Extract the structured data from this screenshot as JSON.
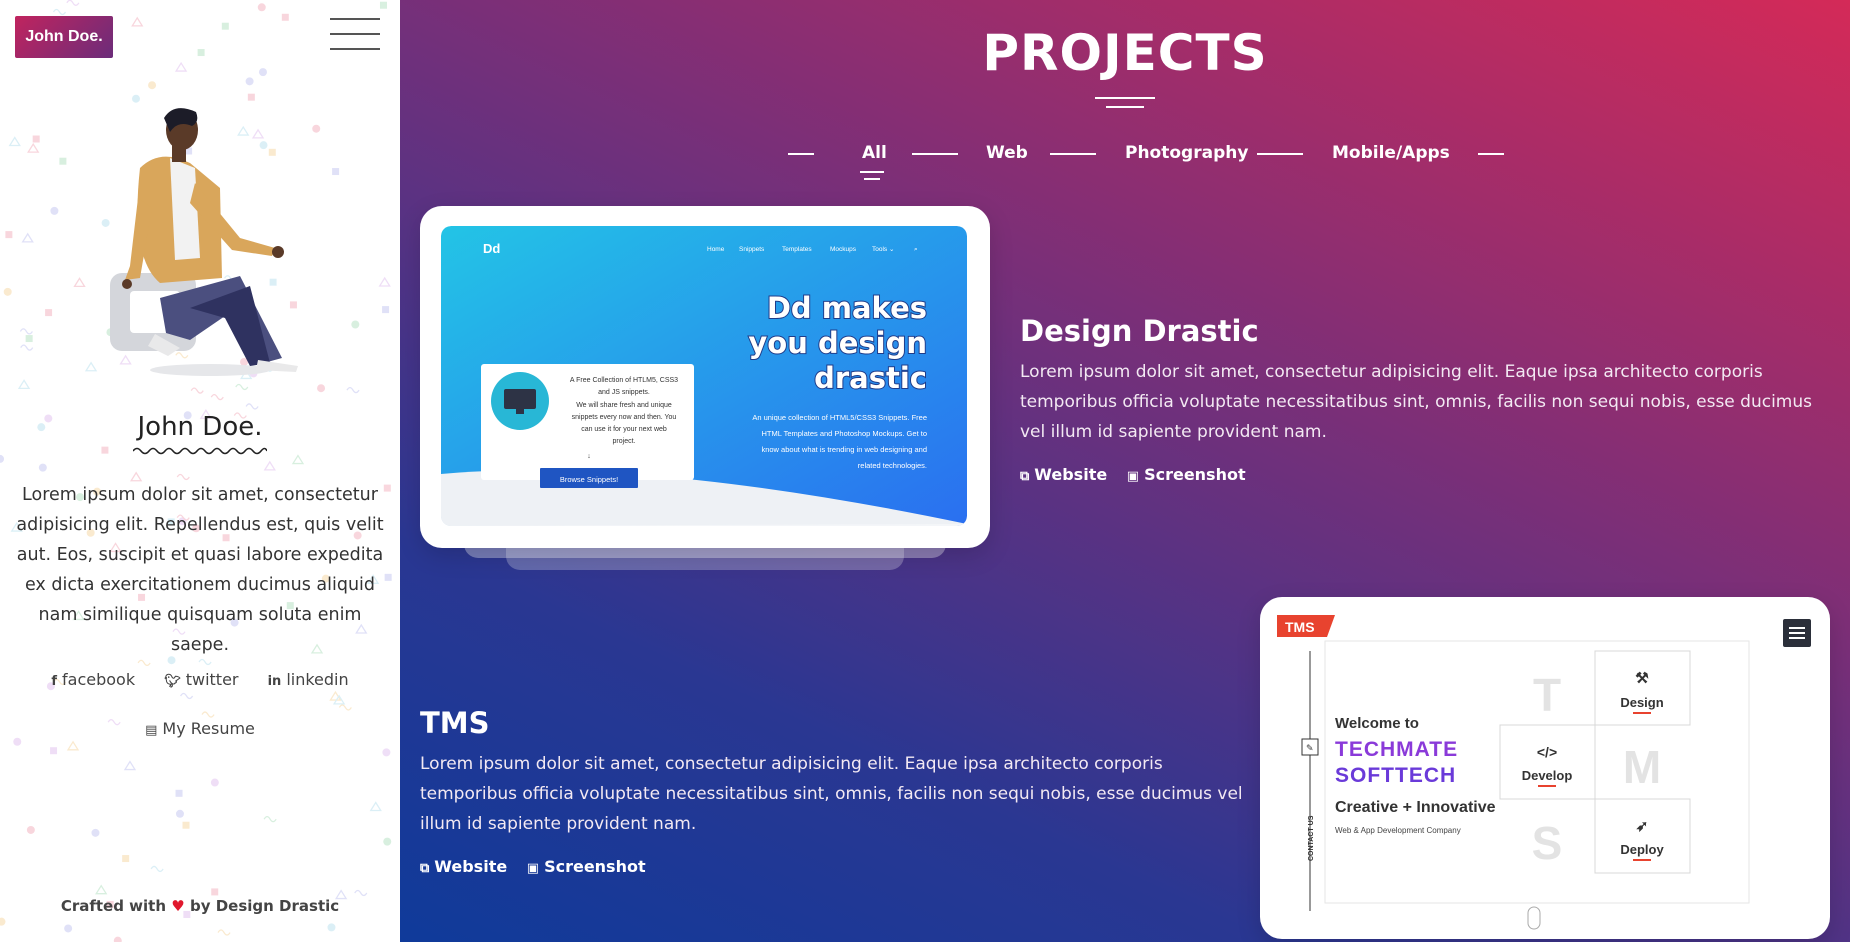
{
  "sidebar": {
    "brand": "John Doe.",
    "name": "John Doe.",
    "bio": "Lorem ipsum dolor sit amet, consectetur adipisicing elit. Repellendus est, quis velit aut. Eos, suscipit et quasi labore expedita ex dicta exercitationem ducimus aliquid nam similique quisquam soluta enim saepe.",
    "socials": [
      {
        "label": "facebook",
        "icon": "facebook-icon"
      },
      {
        "label": "twitter",
        "icon": "twitter-icon"
      },
      {
        "label": "linkedin",
        "icon": "linkedin-icon"
      }
    ],
    "resume": "My Resume",
    "crafted_prefix": "Crafted with",
    "crafted_suffix": "by Design Drastic"
  },
  "main": {
    "title": "PROJECTS",
    "filters": [
      "All",
      "Web",
      "Photography",
      "Mobile/Apps"
    ],
    "active_filter": "All",
    "projects": [
      {
        "title": "Design Drastic",
        "description": "Lorem ipsum dolor sit amet, consectetur adipisicing elit. Eaque ipsa architecto corporis temporibus officia voluptate necessitatibus sint, omnis, facilis non sequi nobis, esse ducimus vel illum id sapiente provident nam.",
        "website_label": "Website",
        "screenshot_label": "Screenshot",
        "preview": {
          "logo": "Dd",
          "nav": [
            "Home",
            "Snippets",
            "Templates",
            "Mockups",
            "Tools ⌄"
          ],
          "headline": [
            "Dd makes",
            "you design",
            "drastic"
          ],
          "sub": [
            "An unique collection of HTML5/CSS3 Snippets. Free",
            "HTML Templates and Photoshop Mockups. Get to",
            "know about what is trending in web designing and",
            "related technologies."
          ],
          "card_text": [
            "A Free Collection of HTLM5, CSS3",
            "and JS snippets.",
            "We will share fresh and unique",
            "snippets every now and then. You",
            "can use it for your next web",
            "project."
          ],
          "card_button": "Browse Snippets!"
        }
      },
      {
        "title": "TMS",
        "description": "Lorem ipsum dolor sit amet, consectetur adipisicing elit. Eaque ipsa architecto corporis temporibus officia voluptate necessitatibus sint, omnis, facilis non sequi nobis, esse ducimus vel illum id sapiente provident nam.",
        "website_label": "Website",
        "screenshot_label": "Screenshot",
        "preview": {
          "badge": "TMS",
          "welcome": "Welcome to",
          "company1": "TECHMATE",
          "company2": "SOFTTECH",
          "tagline": "Creative + Innovative",
          "subtag": "Web & App Development Company",
          "contact": "CONTACT US",
          "tiles": [
            "Design",
            "Develop",
            "Deploy"
          ],
          "letters": [
            "T",
            "M",
            "S"
          ]
        }
      }
    ]
  },
  "colors": {
    "brand_gradient_start": "#c0245e",
    "accent_red": "#e0182d",
    "preview_blue": "#2a8fe8"
  }
}
